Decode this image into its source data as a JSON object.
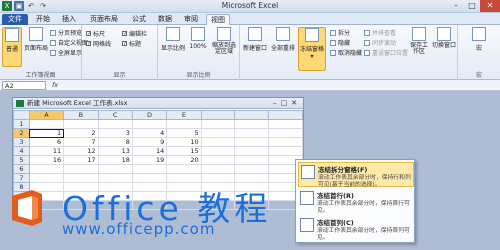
{
  "titlebar": {
    "title": "Microsoft Excel"
  },
  "tabs": [
    {
      "label": "文件"
    },
    {
      "label": "开始"
    },
    {
      "label": "插入"
    },
    {
      "label": "页面布局"
    },
    {
      "label": "公式"
    },
    {
      "label": "数据"
    },
    {
      "label": "审阅"
    },
    {
      "label": "视图"
    }
  ],
  "ribbon": {
    "workbook_views": {
      "normal": "普通",
      "page_layout": "页面布局",
      "page_break": "分页预览",
      "custom": "自定义视图",
      "full": "全屏显示",
      "label": "工作簿视图"
    },
    "show": {
      "ruler": "标尺",
      "formula_bar": "编辑栏",
      "gridlines": "网格线",
      "headings": "标题",
      "label": "显示"
    },
    "zoom": {
      "zoom": "显示比例",
      "pct": "100%",
      "selection": "缩放到选定区域",
      "label": "显示比例"
    },
    "window": {
      "new_window": "新建窗口",
      "arrange": "全部重排",
      "freeze": "冻结窗格",
      "split": "拆分",
      "hide": "隐藏",
      "unhide": "取消隐藏",
      "side": "并排查看",
      "sync": "同步滚动",
      "reset": "重设窗口位置",
      "save_ws": "保存工作区",
      "switch": "切换窗口"
    },
    "macro": {
      "label": "宏"
    }
  },
  "formula_bar": {
    "namebox": "A2",
    "fx": "fx"
  },
  "workbook": {
    "title": "新建 Microsoft Excel 工作表.xlsx",
    "columns": [
      "A",
      "B",
      "C",
      "D",
      "E"
    ],
    "rows": [
      {
        "n": "1",
        "cells": [
          "",
          "",
          "",
          "",
          ""
        ]
      },
      {
        "n": "2",
        "cells": [
          "1",
          "2",
          "3",
          "4",
          "5"
        ]
      },
      {
        "n": "3",
        "cells": [
          "6",
          "7",
          "8",
          "9",
          "10"
        ]
      },
      {
        "n": "4",
        "cells": [
          "11",
          "12",
          "13",
          "14",
          "15"
        ]
      },
      {
        "n": "5",
        "cells": [
          "16",
          "17",
          "18",
          "19",
          "20"
        ]
      },
      {
        "n": "6",
        "cells": [
          "",
          "",
          "",
          "",
          ""
        ]
      },
      {
        "n": "7",
        "cells": [
          "",
          "",
          "",
          "",
          ""
        ]
      },
      {
        "n": "8",
        "cells": [
          "",
          "",
          "",
          "",
          ""
        ]
      },
      {
        "n": "9",
        "cells": [
          "",
          "",
          "",
          "",
          ""
        ]
      },
      {
        "n": "10",
        "cells": [
          "",
          "",
          "",
          "",
          ""
        ]
      }
    ]
  },
  "dropdown": {
    "items": [
      {
        "title": "冻结拆分窗格(F)",
        "desc": "滚动工作表其余部分时，保持行和列可见(基于当前的选择)。"
      },
      {
        "title": "冻结首行(R)",
        "desc": "滚动工作表其余部分时，保持首行可见。"
      },
      {
        "title": "冻结首列(C)",
        "desc": "滚动工作表其余部分时，保持首列可见。"
      }
    ]
  },
  "watermark": {
    "brand": "Office 教程",
    "url": "www.officepp.com"
  },
  "colors": {
    "accent": "#1c6fd6",
    "file_tab": "#2a5cb0",
    "highlight": "#fde9a9"
  }
}
